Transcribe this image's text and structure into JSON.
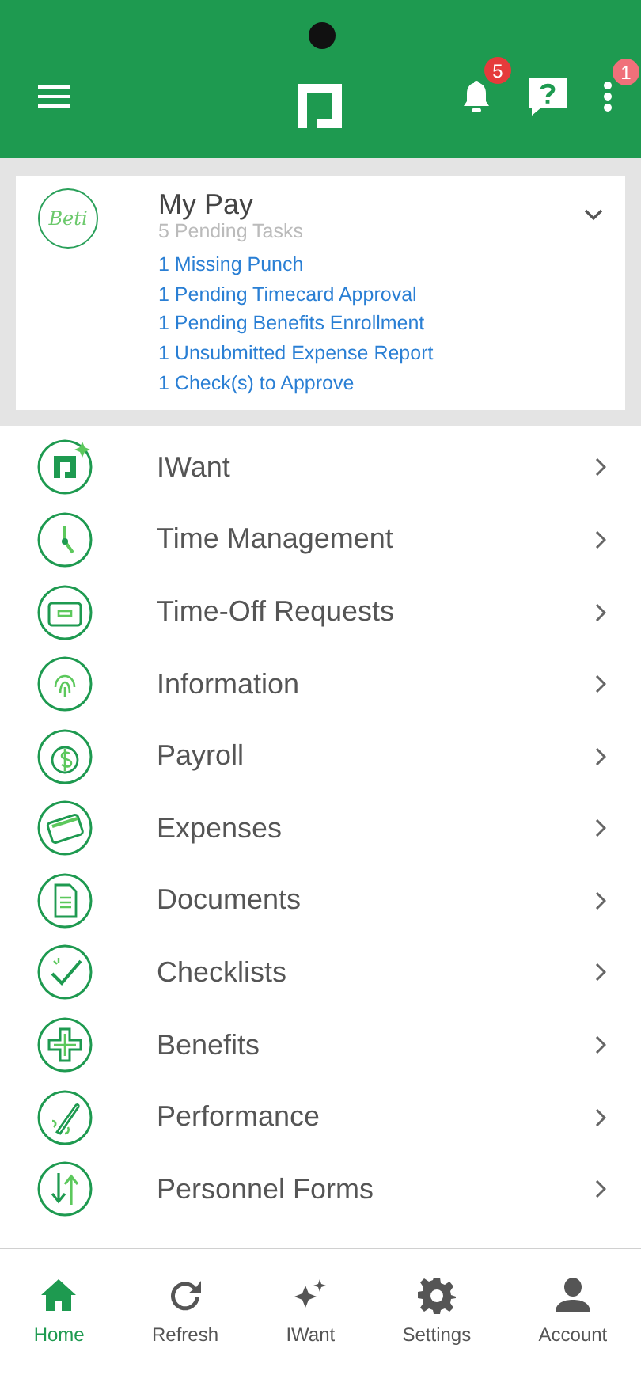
{
  "header": {
    "notification_badge": "5",
    "menu_badge": "1"
  },
  "card": {
    "logo_text": "Beti",
    "title": "My Pay",
    "subtitle": "5 Pending Tasks",
    "expanded": false,
    "tasks": [
      "1 Missing Punch",
      "1 Pending Timecard Approval",
      "1 Pending Benefits Enrollment",
      "1 Unsubmitted Expense Report",
      "1 Check(s) to Approve"
    ]
  },
  "menu": [
    {
      "label": "IWant"
    },
    {
      "label": "Time Management"
    },
    {
      "label": "Time-Off Requests"
    },
    {
      "label": "Information"
    },
    {
      "label": "Payroll"
    },
    {
      "label": "Expenses"
    },
    {
      "label": "Documents"
    },
    {
      "label": "Checklists"
    },
    {
      "label": "Benefits"
    },
    {
      "label": "Performance"
    },
    {
      "label": "Personnel Forms"
    }
  ],
  "bottom_nav": [
    {
      "label": "Home",
      "selected": true
    },
    {
      "label": "Refresh",
      "selected": false
    },
    {
      "label": "IWant",
      "selected": false
    },
    {
      "label": "Settings",
      "selected": false
    },
    {
      "label": "Account",
      "selected": false
    }
  ]
}
